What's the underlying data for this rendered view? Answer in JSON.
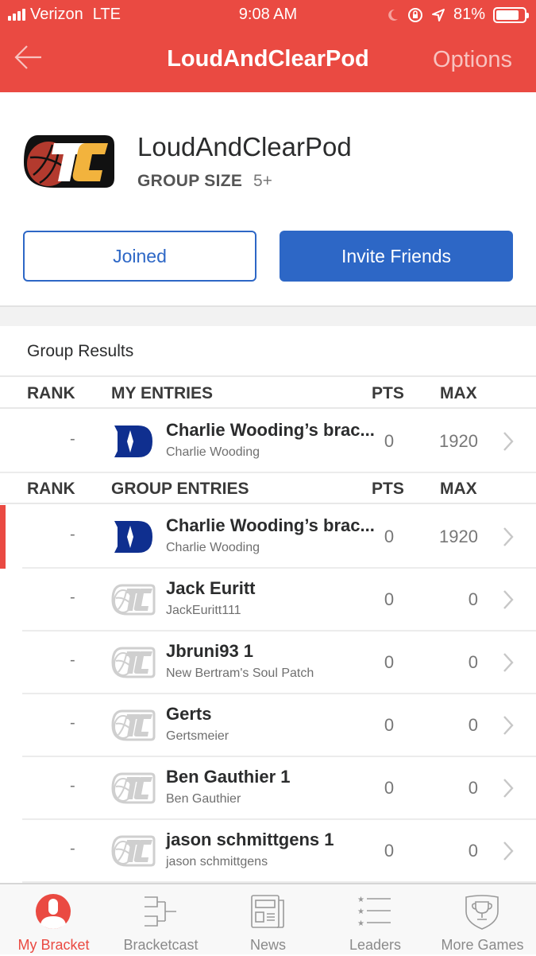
{
  "status_bar": {
    "carrier": "Verizon",
    "network": "LTE",
    "time": "9:08 AM",
    "battery_label": "81%",
    "battery_level": 0.81,
    "icons": [
      "moon-icon",
      "rotation-lock-icon",
      "location-icon",
      "battery-icon"
    ]
  },
  "navbar": {
    "back_icon": "arrow-left-icon",
    "title": "LoudAndClearPod",
    "options_label": "Options"
  },
  "group": {
    "name": "LoudAndClearPod",
    "size_label": "GROUP SIZE",
    "size_value": "5+",
    "logo": "tc-basketball-logo",
    "joined_label": "Joined",
    "invite_label": "Invite Friends"
  },
  "results": {
    "section_title": "Group Results",
    "my_entries_header": {
      "rank": "RANK",
      "entries": "MY ENTRIES",
      "pts": "PTS",
      "max": "MAX"
    },
    "my_entries": [
      {
        "rank": "-",
        "name": "Charlie Wooding’s brac...",
        "owner": "Charlie Wooding",
        "pts": "0",
        "max": "1920",
        "icon": "duke-logo"
      }
    ],
    "group_entries_header": {
      "rank": "RANK",
      "entries": "GROUP ENTRIES",
      "pts": "PTS",
      "max": "MAX"
    },
    "group_entries": [
      {
        "rank": "-",
        "name": "Charlie Wooding’s brac...",
        "owner": "Charlie Wooding",
        "pts": "0",
        "max": "1920",
        "icon": "duke-logo",
        "highlighted": true
      },
      {
        "rank": "-",
        "name": "Jack Euritt",
        "owner": "JackEuritt111",
        "pts": "0",
        "max": "0",
        "icon": "tc-logo-gray"
      },
      {
        "rank": "-",
        "name": "Jbruni93 1",
        "owner": "New Bertram's Soul Patch",
        "pts": "0",
        "max": "0",
        "icon": "tc-logo-gray"
      },
      {
        "rank": "-",
        "name": "Gerts",
        "owner": "Gertsmeier",
        "pts": "0",
        "max": "0",
        "icon": "tc-logo-gray"
      },
      {
        "rank": "-",
        "name": "Ben Gauthier 1",
        "owner": "Ben Gauthier",
        "pts": "0",
        "max": "0",
        "icon": "tc-logo-gray"
      },
      {
        "rank": "-",
        "name": "jason schmittgens 1",
        "owner": "jason schmittgens",
        "pts": "0",
        "max": "0",
        "icon": "tc-logo-gray"
      }
    ]
  },
  "tabbar": {
    "tabs": [
      {
        "label": "My Bracket",
        "icon": "user-icon",
        "active": true
      },
      {
        "label": "Bracketcast",
        "icon": "bracket-icon",
        "active": false
      },
      {
        "label": "News",
        "icon": "newspaper-icon",
        "active": false
      },
      {
        "label": "Leaders",
        "icon": "star-list-icon",
        "active": false
      },
      {
        "label": "More Games",
        "icon": "trophy-shield-icon",
        "active": false
      }
    ]
  },
  "colors": {
    "brand_red": "#ea4a42",
    "action_blue": "#2d67c6",
    "duke_blue": "#0f2f8f",
    "logo_gold": "#f2b33d",
    "logo_ball": "#b33a2e"
  }
}
